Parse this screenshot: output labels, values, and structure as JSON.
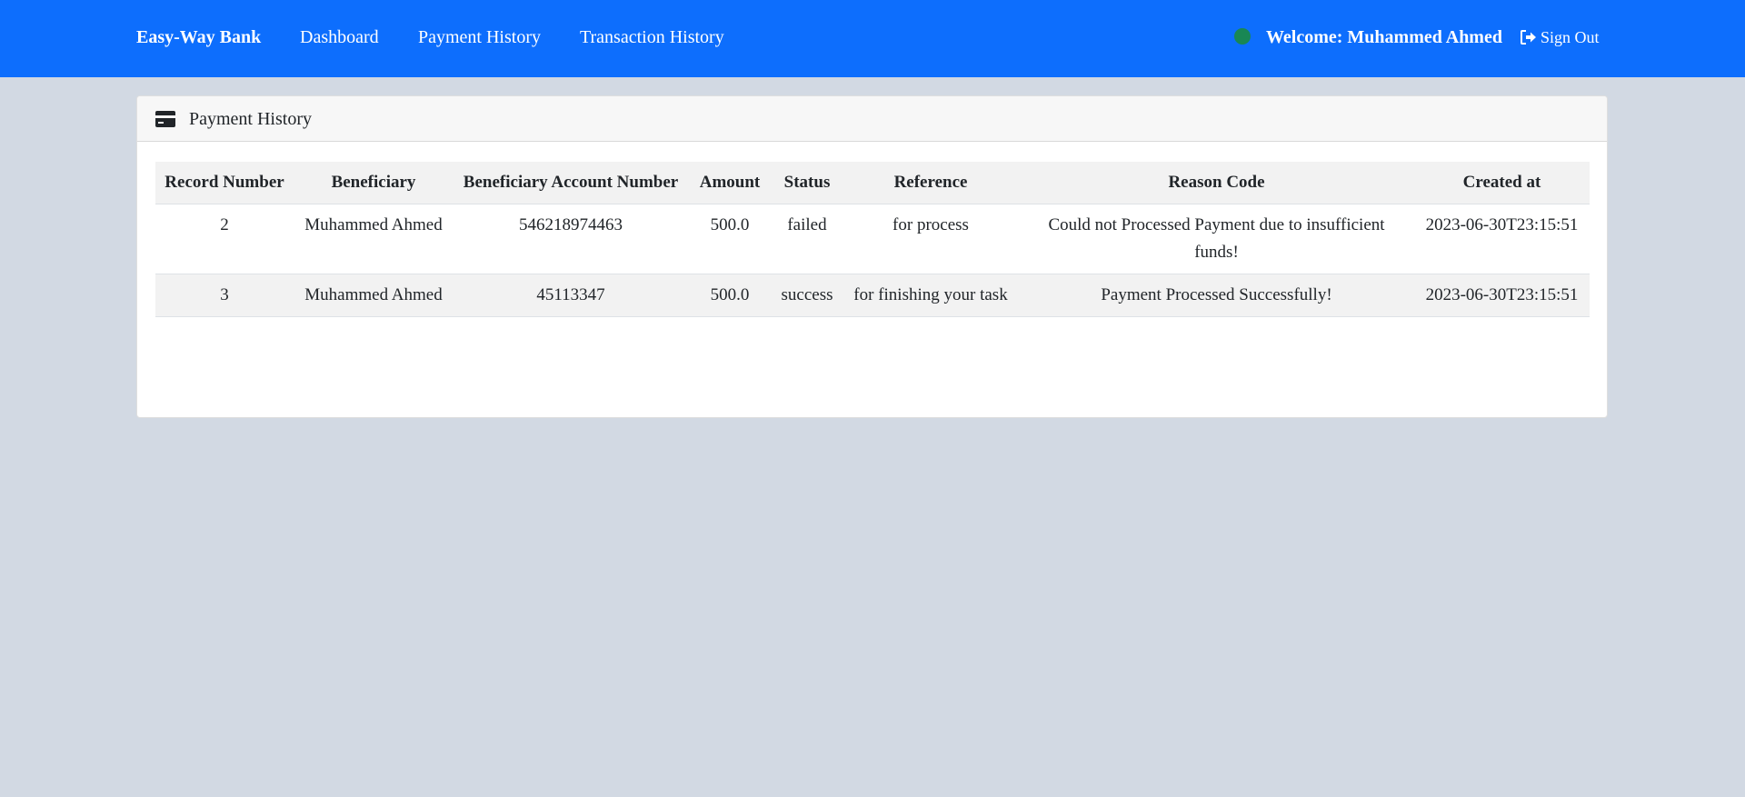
{
  "navbar": {
    "brand": "Easy-Way Bank",
    "links": [
      "Dashboard",
      "Payment History",
      "Transaction History"
    ],
    "welcome": "Welcome: Muhammed Ahmed",
    "sign_out": "Sign Out",
    "status_color": "#198754",
    "background": "#0d6efd"
  },
  "card": {
    "icon": "credit-card-icon",
    "title": "Payment History"
  },
  "table": {
    "headers": [
      "Record Number",
      "Beneficiary",
      "Beneficiary Account Number",
      "Amount",
      "Status",
      "Reference",
      "Reason Code",
      "Created at"
    ],
    "rows": [
      [
        "2",
        "Muhammed Ahmed",
        "546218974463",
        "500.0",
        "failed",
        "for process",
        "Could not Processed Payment due to insufficient funds!",
        "2023-06-30T23:15:51"
      ],
      [
        "3",
        "Muhammed Ahmed",
        "45113347",
        "500.0",
        "success",
        "for finishing your task",
        "Payment Processed Successfully!",
        "2023-06-30T23:15:51"
      ]
    ]
  }
}
